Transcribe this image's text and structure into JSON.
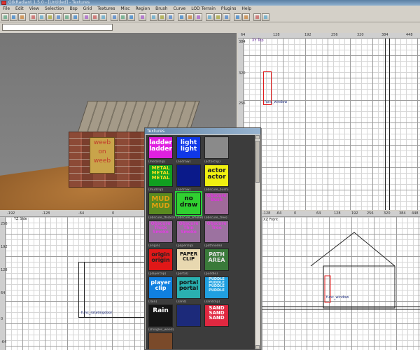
{
  "window": {
    "title": "GtkRadiant 1.5.0 - [Untitled] - Textures"
  },
  "menu": [
    "File",
    "Edit",
    "View",
    "Selection",
    "Bsp",
    "Grid",
    "Textures",
    "Misc",
    "Region",
    "Brush",
    "Curve",
    "LOD Terrain",
    "Plugins",
    "Help"
  ],
  "command_input": {
    "value": ""
  },
  "camera": {
    "door_text": [
      "weeb",
      "on",
      "weeb"
    ]
  },
  "xy_view": {
    "label": "XY Top",
    "top_ticks": [
      "64",
      "128",
      "192",
      "256",
      "320",
      "384",
      "448"
    ],
    "left_ticks": [
      "384",
      "320",
      "256"
    ],
    "brush_label": "func_window"
  },
  "yz_view": {
    "label": "YZ Side",
    "top_ticks": [
      "-192",
      "-128",
      "-64",
      "0",
      "64",
      "128"
    ],
    "left_ticks": [
      "256",
      "192",
      "128",
      "64",
      "0",
      "-64"
    ],
    "brush_label": "func_rotatingdoor"
  },
  "xz_view": {
    "label": "XZ Front",
    "top_ticks": [
      "-128",
      "-64",
      "0",
      "64",
      "128",
      "192",
      "256",
      "320",
      "384",
      "448"
    ],
    "brush_label": "func_window"
  },
  "textures": {
    "title": "Textures",
    "items": [
      {
        "name": "",
        "lines": [
          "ladder",
          "ladder"
        ],
        "bg": "#e020e0",
        "fg": "#ffffff",
        "fs": 9
      },
      {
        "name": "",
        "lines": [
          "light",
          "light"
        ],
        "bg": "#1038e8",
        "fg": "#ffffff",
        "fs": 9
      },
      {
        "name": "",
        "lines": [],
        "bg": "#8a8a8a",
        "fg": "#ffffff",
        "fs": 8
      },
      {
        "name": "(metalclip)",
        "lines": [
          "METAL",
          "METAL",
          "METAL"
        ],
        "bg": "#10a020",
        "fg": "#f0e020",
        "fs": 7
      },
      {
        "name": "(nodraw)",
        "lines": [],
        "bg": "#0a1a8a",
        "fg": "#ffffff",
        "fs": 8
      },
      {
        "name": "(actorclip)",
        "lines": [
          "actor",
          "actor"
        ],
        "bg": "#f0f010",
        "fg": "#222222",
        "fs": 9
      },
      {
        "name": "(mudclip)",
        "lines": [
          "MUD",
          "MUD"
        ],
        "bg": "#5a8a20",
        "fg": "#e0a010",
        "fs": 10
      },
      {
        "name": "(nodraw)",
        "lines": [
          "no",
          "draw"
        ],
        "bg": "#30d030",
        "fg": "#111111",
        "fs": 9
      },
      {
        "name": "(obscure_bush)",
        "lines": [
          "Obscure",
          "",
          "Bush"
        ],
        "bg": "#a06a9a",
        "fg": "#e030e0",
        "fs": 6
      },
      {
        "name": "(obscure_thicksmoke)",
        "lines": [
          "Obscure",
          "Thick",
          "Smoke"
        ],
        "bg": "#9c72a0",
        "fg": "#e040e0",
        "fs": 6
      },
      {
        "name": "(obscure_smoke)",
        "lines": [
          "Obscure",
          "Thin",
          "Smoke"
        ],
        "bg": "#9c72a0",
        "fg": "#e040e0",
        "fs": 6
      },
      {
        "name": "(obscure_tree)",
        "lines": [
          "Obscure",
          "",
          "Tree"
        ],
        "bg": "#9c72a0",
        "fg": "#e040e0",
        "fs": 6
      },
      {
        "name": "(origin)",
        "lines": [
          "origin",
          "origin"
        ],
        "bg": "#e01818",
        "fg": "#222222",
        "fs": 8
      },
      {
        "name": "(paperclip)",
        "lines": [
          "PAPER",
          "CLIP"
        ],
        "bg": "#e8d8b0",
        "fg": "#111111",
        "fs": 7
      },
      {
        "name": "(pathnode)",
        "lines": [
          "PATH",
          "AREA"
        ],
        "bg": "#3a7a3a",
        "fg": "#e0e0e0",
        "fs": 8
      },
      {
        "name": "(playerclip)",
        "lines": [
          "player",
          "clip"
        ],
        "bg": "#1080e0",
        "fg": "#ffffff",
        "fs": 8
      },
      {
        "name": "(portal)",
        "lines": [
          "portal",
          "portal"
        ],
        "bg": "#2ab0b0",
        "fg": "#111111",
        "fs": 8
      },
      {
        "name": "(puddle)",
        "lines": [
          "PUDDLE",
          "PUDDLE",
          "PUDDLE",
          "PUDDLE"
        ],
        "bg": "#20a0e0",
        "fg": "#e0f8ff",
        "fs": 5
      },
      {
        "name": "(rain)",
        "lines": [
          "Rain"
        ],
        "bg": "#151515",
        "fg": "#ffffff",
        "fs": 9
      },
      {
        "name": "(sand)",
        "lines": [],
        "bg": "#1c2a7a",
        "fg": "#ffffff",
        "fs": 8
      },
      {
        "name": "(sandclip)",
        "lines": [
          "SAND",
          "SAND",
          "SAND"
        ],
        "bg": "#e02840",
        "fg": "#ffffff",
        "fs": 7
      },
      {
        "name": "(shingles_weed)",
        "lines": [],
        "bg": "#7a4a2a",
        "fg": "#ffffff",
        "fs": 8
      }
    ]
  }
}
